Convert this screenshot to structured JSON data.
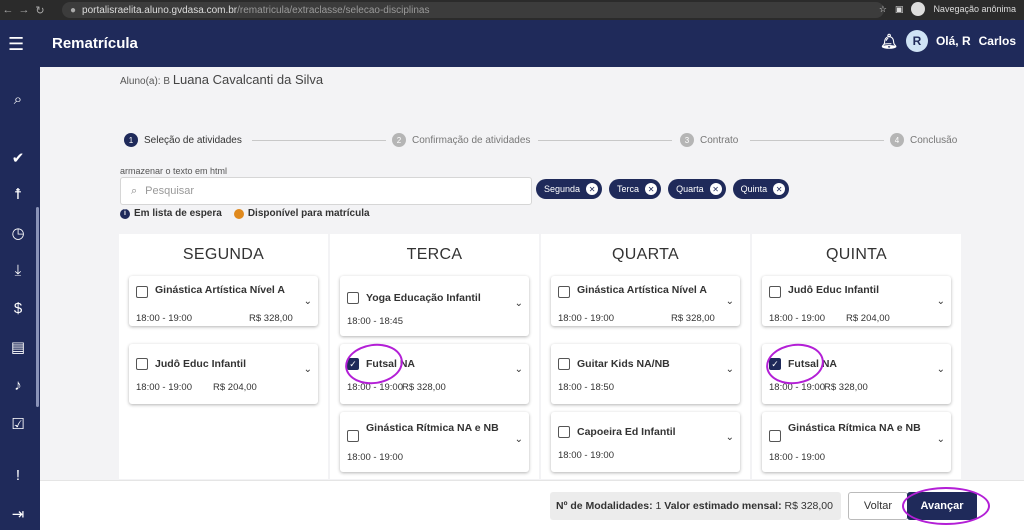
{
  "browser": {
    "url_host": "portalisraelita.aluno.gvdasa.com.br",
    "url_path": "/rematricula/extraclasse/selecao-disciplinas",
    "incognito_label": "Navegação anônima"
  },
  "header": {
    "title": "Rematrícula",
    "avatar_letter": "R",
    "greeting": "Olá, R",
    "user_name": "Carlos"
  },
  "student": {
    "label": "Aluno(a): B",
    "name": "Luana Cavalcanti da Silva"
  },
  "steps": [
    {
      "num": "1",
      "label": "Seleção de atividades"
    },
    {
      "num": "2",
      "label": "Confirmação de atividades"
    },
    {
      "num": "3",
      "label": "Contrato"
    },
    {
      "num": "4",
      "label": "Conclusão"
    }
  ],
  "search": {
    "label": "armazenar o texto em html",
    "placeholder": "Pesquisar"
  },
  "chips": [
    "Segunda",
    "Terca",
    "Quarta",
    "Quinta"
  ],
  "legend": {
    "waitlist": "Em lista de espera",
    "available": "Disponível para matrícula"
  },
  "columns": [
    {
      "day": "SEGUNDA",
      "cards": [
        {
          "title": "Ginástica Artística Nível A",
          "time": "18:00 - 19:00",
          "price": "R$ 328,00",
          "checked": false
        },
        {
          "title": "Judô Educ Infantil",
          "time": "18:00 - 19:00",
          "price": "R$ 204,00",
          "checked": false
        }
      ]
    },
    {
      "day": "TERCA",
      "cards": [
        {
          "title": "Yoga Educação Infantil",
          "time": "18:00 - 18:45",
          "price": "",
          "checked": false
        },
        {
          "title": "Futsal NA",
          "time": "18:00 - 19:00",
          "price": "R$ 328,00",
          "checked": true
        },
        {
          "title": "Ginástica Rítmica NA e NB",
          "time": "18:00 - 19:00",
          "price": "",
          "checked": false
        }
      ]
    },
    {
      "day": "QUARTA",
      "cards": [
        {
          "title": "Ginástica Artística Nível A",
          "time": "18:00 - 19:00",
          "price": "R$ 328,00",
          "checked": false
        },
        {
          "title": "Guitar Kids NA/NB",
          "time": "18:00 - 18:50",
          "price": "",
          "checked": false
        },
        {
          "title": "Capoeira Ed Infantil",
          "time": "18:00 - 19:00",
          "price": "",
          "checked": false
        }
      ]
    },
    {
      "day": "QUINTA",
      "cards": [
        {
          "title": "Judô Educ Infantil",
          "time": "18:00 - 19:00",
          "price": "R$ 204,00",
          "checked": false
        },
        {
          "title": "Futsal NA",
          "time": "18:00 - 19:00",
          "price": "R$ 328,00",
          "checked": true
        },
        {
          "title": "Ginástica Rítmica NA e NB",
          "time": "18:00 - 19:00",
          "price": "",
          "checked": false
        }
      ]
    }
  ],
  "footer": {
    "modalities_label": "Nº de Modalidades:",
    "modalities_value": "1",
    "estimate_label": "Valor estimado mensal:",
    "estimate_value": "R$ 328,00",
    "back_label": "Voltar",
    "next_label": "Avançar"
  },
  "colors": {
    "primary": "#1f2a5a",
    "waitlist": "#1f2a5a",
    "available": "#e08a1e",
    "annotation": "#b31fd6"
  }
}
